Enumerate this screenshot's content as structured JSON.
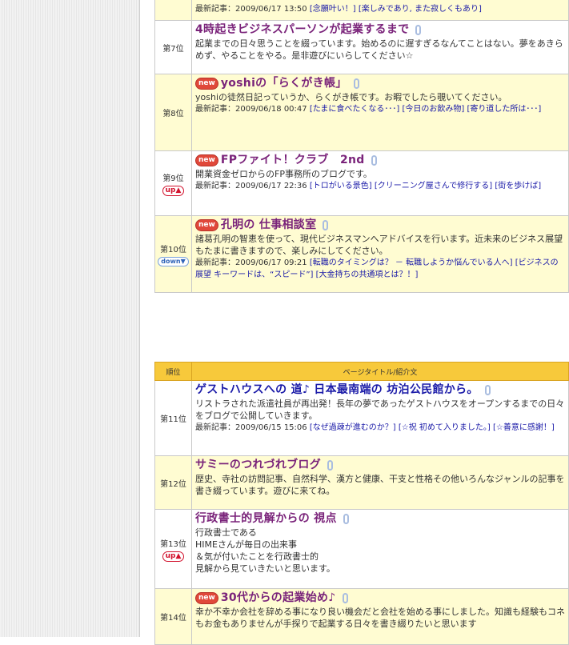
{
  "latest_label": "最新記事：",
  "table1": {
    "rows": [
      {
        "rank": "",
        "trend": "",
        "title": "",
        "is_new": false,
        "desc": "",
        "date": "2009/06/17 13:50",
        "links": [
          "[念願叶い！]",
          "[楽しみであり, また寂しくもあり]"
        ],
        "bg": "yel",
        "partial": true
      },
      {
        "rank": "第7位",
        "trend": "",
        "title": "4時起きビジネスパーソンが起業するまで",
        "is_new": false,
        "desc": "起業までの日々思うことを綴っています。始めるのに遅すぎるなんてことはない。夢をあきらめず、やることをやる。是非遊びにいらしてください☆",
        "date": "",
        "links": [],
        "bg": "wht"
      },
      {
        "rank": "第8位",
        "trend": "",
        "title": "yoshiの「らくがき帳」",
        "is_new": true,
        "desc": "yoshiの徒然日記っていうか、らくがき帳です。お暇でしたら覗いてください。",
        "date": "2009/06/18 00:47",
        "links": [
          "[たまに食べたくなる･･･]",
          "[今日のお飲み物]",
          "[寄り道した所は･･･]"
        ],
        "bg": "yel"
      },
      {
        "rank": "第9位",
        "trend": "up▲",
        "title": "FPファイト！クラブ　2nd",
        "is_new": true,
        "desc": "開業資金ゼロからのFP事務所のブログです。",
        "date": "2009/06/17 22:36",
        "links": [
          "[トロがいる景色]",
          "[クリーニング屋さんで修行する]",
          "[街を歩けば]"
        ],
        "bg": "wht"
      },
      {
        "rank": "第10位",
        "trend": "down▼",
        "title": "孔明の 仕事相談室",
        "is_new": true,
        "desc": "諸葛孔明の智恵を使って、現代ビジネスマンへアドバイスを行います。近未来のビジネス展望もたまに書きますので、楽しみにしてください。",
        "date": "2009/06/17 09:21",
        "links": [
          "[転職のタイミングは？ － 転職しようか悩んでいる人へ]",
          "[ビジネスの展望 キーワードは、“スピード”]",
          "[大金持ちの共通項とは？！]"
        ],
        "bg": "yel"
      }
    ]
  },
  "table2": {
    "header": {
      "rank": "順位",
      "title": "ページタイトル/紹介文"
    },
    "rows": [
      {
        "rank": "第11位",
        "trend": "",
        "title": "ゲストハウスへの 道♪ 日本最南端の 坊泊公民館から。",
        "is_new": false,
        "blue": true,
        "desc": "リストラされた派遣社員が再出発！長年の夢であったゲストハウスをオープンするまでの日々をブログで公開していきます。",
        "date": "2009/06/15 15:06",
        "links": [
          "[なぜ過疎が進むのか？]",
          "[☆祝 初めて入りました。]",
          "[☆善意に感謝！]"
        ],
        "bg": "wht"
      },
      {
        "rank": "第12位",
        "trend": "",
        "title": "サミーのつれづれブログ",
        "is_new": false,
        "desc": "歴史、寺社の訪問記事、自然科学、漢方と健康、干支と性格その他いろんなジャンルの記事を書き綴っています。遊びに来てね。",
        "date": "",
        "links": [],
        "bg": "yel"
      },
      {
        "rank": "第13位",
        "trend": "up▲",
        "title": "行政書士的見解からの 視点",
        "is_new": false,
        "desc_lines": [
          "行政書士である",
          "HIMEさんが毎日の出来事",
          "＆気が付いたことを行政書士的",
          "見解から見ていきたいと思います。"
        ],
        "date": "",
        "links": [],
        "bg": "wht"
      },
      {
        "rank": "第14位",
        "trend": "",
        "title": "30代からの起業始め♪",
        "is_new": true,
        "desc": "幸か不幸か会社を辞める事になり良い機会だと会社を始める事にしました。知識も経験もコネもお金もありませんが手探りで起業する日々を書き綴りたいと思います",
        "date": "",
        "links": [],
        "bg": "yel"
      }
    ]
  }
}
